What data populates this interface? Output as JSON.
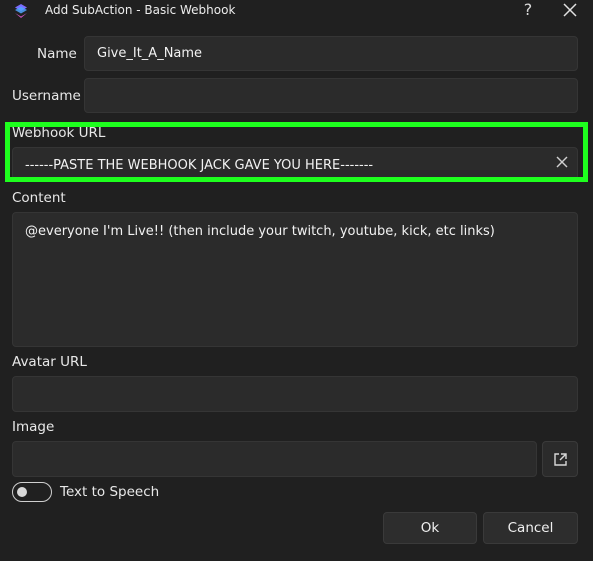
{
  "window": {
    "title": "Add SubAction - Basic Webhook",
    "help_label": "?",
    "app_icon": "streamer-bot-logo-icon",
    "close_icon": "close-icon"
  },
  "form": {
    "name": {
      "label": "Name",
      "value": "Give_It_A_Name"
    },
    "username": {
      "label": "Username",
      "value": ""
    },
    "webhook_url": {
      "label": "Webhook URL",
      "value": "------PASTE THE WEBHOOK JACK GAVE YOU HERE-------",
      "highlight_color": "#1eff1e"
    },
    "content": {
      "label": "Content",
      "value": "@everyone I'm Live!! (then include your twitch, youtube, kick, etc links)"
    },
    "avatar_url": {
      "label": "Avatar URL",
      "value": ""
    },
    "image": {
      "label": "Image",
      "value": "",
      "browse_icon": "open-external-icon"
    },
    "tts": {
      "label": "Text to Speech",
      "enabled": false
    }
  },
  "buttons": {
    "ok": "Ok",
    "cancel": "Cancel"
  }
}
